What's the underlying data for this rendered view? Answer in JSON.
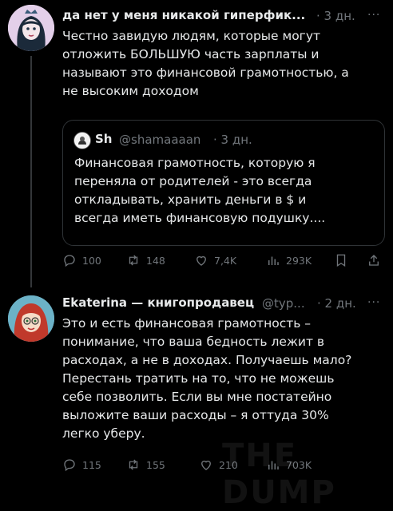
{
  "tweet1": {
    "author_name": "да нет у меня никакой гиперфик...",
    "time": "· 3 дн.",
    "more": "···",
    "text": "Честно завидую людям, которые могут\nотложить БОЛЬШУЮ часть зарплаты и\nназывают это финансовой грамотностью, а\nне высоким доходом",
    "quote": {
      "author_name": "Sh",
      "handle": "@shamaaaan",
      "time": "· 3 дн.",
      "text": "Финансовая грамотность, которую я\nпереняла от родителей - это всегда\nоткладывать, хранить деньги в $ и\nвсегда иметь финансовую подушку...."
    },
    "actions": {
      "replies": "100",
      "retweets": "148",
      "likes": "7,4K",
      "views": "293K"
    }
  },
  "tweet2": {
    "author_name": "Ekaterina — книгопродавец",
    "handle": "@typ...",
    "time": "· 2 дн.",
    "more": "···",
    "text": "Это и есть финансовая грамотность –\nпонимание, что ваша бедность лежит в\nрасходах, а не в доходах. Получаешь мало?\nПерестань тратить на то, что не можешь\nсебе позволить. Если вы мне постатейно\nвыложите ваши расходы – я оттуда 30%\nлегко уберу.",
    "actions": {
      "replies": "115",
      "retweets": "155",
      "likes": "210",
      "views": "703K"
    }
  },
  "watermark": "THE DUMP",
  "colors": {
    "background": "#000000",
    "text": "#e7e9ea",
    "muted": "#71767b",
    "border": "#2f3336"
  }
}
